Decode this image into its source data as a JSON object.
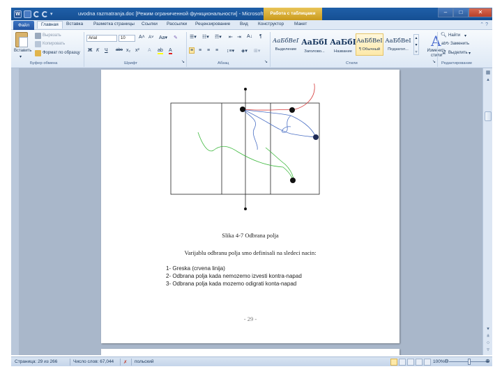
{
  "window": {
    "title": "uvodna razmatranja.doc [Режим ограниченной функциональности] - Microsoft Word",
    "contextual_tab": "Работа с таблицами",
    "controls": {
      "minimize": "–",
      "maximize": "□",
      "close": "✕"
    }
  },
  "tabs": {
    "file": "Файл",
    "items": [
      "Главная",
      "Вставка",
      "Разметка страницы",
      "Ссылки",
      "Рассылки",
      "Рецензирование",
      "Вид",
      "Конструктор",
      "Макет"
    ],
    "active": "Главная"
  },
  "ribbon": {
    "clipboard": {
      "paste": "Вставить",
      "cut": "Вырезать",
      "copy": "Копировать",
      "format_painter": "Формат по образцу",
      "group_label": "Буфер обмена"
    },
    "font": {
      "font_name": "Arial",
      "font_size": "10",
      "group_label": "Шрифт"
    },
    "paragraph": {
      "group_label": "Абзац"
    },
    "styles": {
      "items": [
        {
          "sample": "AaБбВеГ",
          "name": "Выделение"
        },
        {
          "sample": "AaБбI",
          "name": "Заголово..."
        },
        {
          "sample": "AaБбI",
          "name": "Название"
        },
        {
          "sample": "AaБбВеI",
          "name": "¶ Обычный"
        },
        {
          "sample": "AaБбВеI",
          "name": "Подзагол..."
        }
      ],
      "selected": "¶ Обычный",
      "change_styles": "Изменить стили",
      "group_label": "Стили"
    },
    "editing": {
      "find": "Найти",
      "replace": "Заменить",
      "select": "Выделить",
      "group_label": "Редактирование"
    }
  },
  "document": {
    "caption": "Slika 4-7 Odbrana polja",
    "paragraph": "Varijablu odbranu polja smo definisali na sledeci nacin:",
    "list": [
      "1-   Greska (crvena linija)",
      "2-   Odbrana polja kada nemozemo izvesti kontra-napad",
      "3-   Odbrana polja kada mozemo odigrati konta-napad"
    ],
    "page_number": "- 29 -",
    "line_colors": {
      "red": "#d63b3b",
      "blue": "#4a6fc4",
      "green": "#3cb83c"
    }
  },
  "statusbar": {
    "page": "Страница: 29 из 266",
    "words": "Число слов: 67,044",
    "language": "польский",
    "zoom": "100%"
  }
}
